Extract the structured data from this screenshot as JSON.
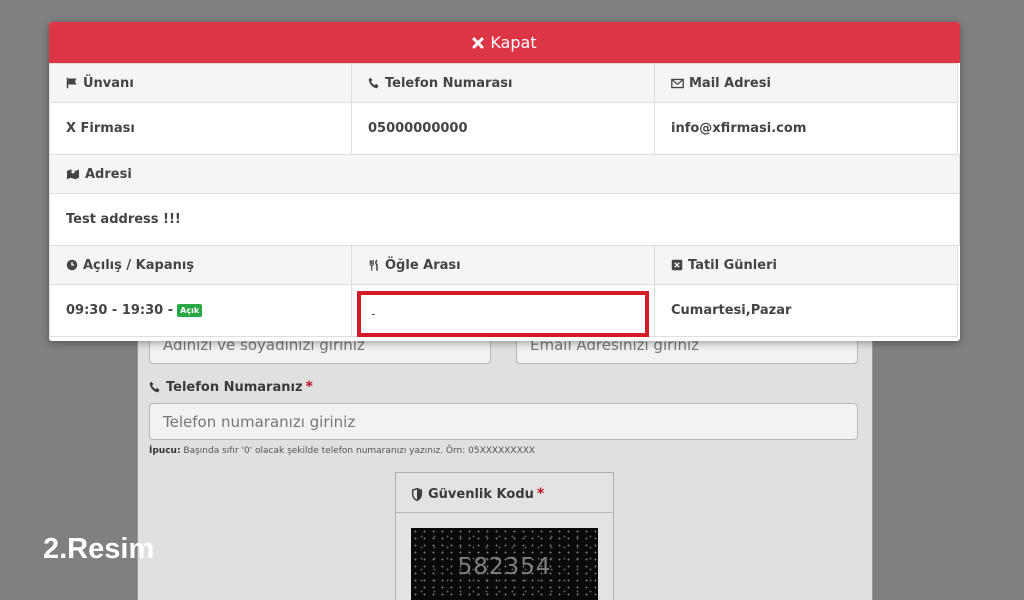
{
  "background_form": {
    "name_placeholder": "Adınızı ve soyadınızı giriniz",
    "email_placeholder": "Email Adresinizi giriniz",
    "phone_label": "Telefon Numaranız",
    "phone_placeholder": "Telefon numaranızı giriniz",
    "hint_bold": "İpucu:",
    "hint_text": " Başında sıfır '0' olacak şekilde telefon numaranızı yazınız. Örn: 05XXXXXXXXX",
    "captcha_label": "Güvenlik Kodu",
    "captcha_code": "582354",
    "required_mark": "*"
  },
  "overlay_label": "2.Resim",
  "modal": {
    "close_label": "Kapat",
    "headers": {
      "title": "Ünvanı",
      "phone": "Telefon Numarası",
      "mail": "Mail Adresi",
      "address": "Adresi",
      "hours": "Açılış / Kapanış",
      "lunch": "Öğle Arası",
      "holidays": "Tatil Günleri"
    },
    "values": {
      "title": "X Firması",
      "phone": "05000000000",
      "mail": "info@xfirmasi.com",
      "address": "Test address !!!",
      "hours": "09:30 - 19:30 -",
      "status_badge": "Açık",
      "lunch": "-",
      "holidays": "Cumartesi,Pazar"
    }
  },
  "colors": {
    "close_bar": "#dc3545",
    "badge": "#28a745",
    "highlight_border": "#d41a26",
    "backdrop": "#808080"
  },
  "icons": [
    "close-icon",
    "flag-icon",
    "phone-icon",
    "envelope-icon",
    "map-icon",
    "clock-icon",
    "cutlery-icon",
    "calendar-x-icon",
    "shield-icon"
  ]
}
